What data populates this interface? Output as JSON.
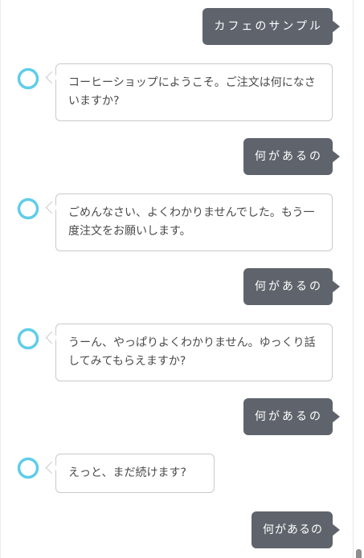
{
  "colors": {
    "user_bubble": "#5f646c",
    "bot_border": "#c9c9c9",
    "avatar_ring": "#5fcde9"
  },
  "messages": [
    {
      "sender": "user",
      "text": "カフェのサンプル"
    },
    {
      "sender": "bot",
      "avatar_icon": "assistant-ring-icon",
      "text": "コーヒーショップにようこそ。ご注文は何になさいますか?"
    },
    {
      "sender": "user",
      "text": "何があるの"
    },
    {
      "sender": "bot",
      "avatar_icon": "assistant-ring-icon",
      "text": "ごめんなさい、よくわかりませんでした。もう一度注文をお願いします。"
    },
    {
      "sender": "user",
      "text": "何があるの"
    },
    {
      "sender": "bot",
      "avatar_icon": "assistant-ring-icon",
      "text": "うーん、やっぱりよくわかりません。ゆっくり話してみてもらえますか?"
    },
    {
      "sender": "user",
      "text": "何があるの"
    },
    {
      "sender": "bot",
      "avatar_icon": "assistant-ring-icon",
      "text": "えっと、まだ続けます?"
    },
    {
      "sender": "user",
      "text": "何があるの"
    }
  ]
}
